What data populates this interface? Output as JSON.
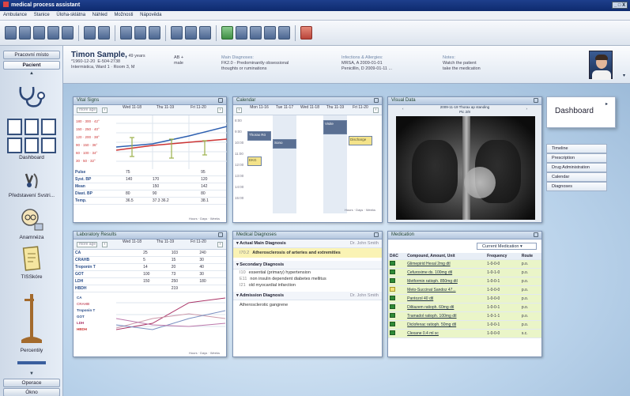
{
  "window": {
    "title": "medical process assistant",
    "control": "_ □ X"
  },
  "menu": [
    "Ambulance",
    "Stanice",
    "Úloha-sklátna",
    "Náhled",
    "Možnosti",
    "Nápověda"
  ],
  "nav": {
    "top_buttons": [
      "Pracovní místo",
      "Pacient"
    ],
    "items": [
      "Dashboard",
      "Představení Svstri...",
      "Anamnéza",
      "TISSkóre",
      "Percentily"
    ],
    "bottom_buttons": [
      "Operace",
      "Ókno"
    ]
  },
  "patient": {
    "name": "Timon Sample,",
    "age": "49 years",
    "dob": "*1960-12-20",
    "id": "E-504-2738",
    "location": "Intermistica, Ward 1 · Room 3, M",
    "blood": "AB +",
    "sex": "male",
    "main_diag_head": "Main Diagnoses:",
    "main_diag": [
      "FK2.0 - Predominantly obsessional",
      "thoughts or ruminations"
    ],
    "inf_head": "Infections & Allergies:",
    "infections": [
      "MRSA, A 2009-01-01",
      "Penicillin, D 2009-01-11 ..."
    ],
    "notes_head": "Notes:",
    "notes": [
      "Watch the patient",
      "take the medication"
    ]
  },
  "vital": {
    "title": "Vital Signs",
    "dd": "more age",
    "cols": [
      "Wed 11-18",
      "Thu 11-19",
      "Fri 11-20"
    ],
    "scale": [
      "180 · 300 · 42°",
      "150 · 250 · 40°",
      "120 · 200 · 38°",
      "90 · 150 · 36°",
      "60 · 100 · 34°",
      "30 · 50 · 32°"
    ],
    "rows": [
      [
        "Pulse",
        "75",
        "",
        "95"
      ],
      [
        "Syst. BP",
        "140",
        "170",
        "120"
      ],
      [
        "Mean",
        "",
        "150",
        "142"
      ],
      [
        "Diast. BP",
        "80",
        "90",
        "80"
      ],
      [
        "Temp.",
        "36.5",
        "37.3 36.2",
        "38.1"
      ]
    ],
    "zoom": "Hours · Days · Weeks"
  },
  "calendar": {
    "title": "Calendar",
    "cols": [
      "Mon 11-16",
      "Tue 11-17",
      "Wed 11-18",
      "Thu 11-19",
      "Fri 11-20"
    ],
    "times": [
      "8:00",
      "9:00",
      "10:00",
      "11:00",
      "12:00",
      "13:00",
      "14:00",
      "15:00"
    ],
    "events": [
      "Thorax Rö",
      "Sono",
      "EKG",
      "Visite",
      "Discharge"
    ],
    "zoom": "Hours · Days · Weeks"
  },
  "visual": {
    "title": "Visual Data",
    "caption": "2009-11-19 Thorax ap standing",
    "page": "Pic 2/8"
  },
  "dashboard_tab": "Dashboard",
  "side_tabs": [
    "Timeline",
    "Prescription",
    "Drug Administration",
    "Calendar",
    "Diagnoses"
  ],
  "lab": {
    "title": "Laboratory Results",
    "dd": "more age",
    "cols": [
      "Wed 11-18",
      "Thu 11-19",
      "Fri 11-20"
    ],
    "rows": [
      [
        "CA",
        "",
        "25",
        "103",
        "240"
      ],
      [
        "CRAHB",
        "",
        "5",
        "15",
        "30"
      ],
      [
        "Troponin T",
        "",
        "14",
        "20",
        "40"
      ],
      [
        "GOT",
        "",
        "100",
        "73",
        "30"
      ],
      [
        "LDH",
        "",
        "150",
        "250",
        "180"
      ],
      [
        "HBDH",
        "",
        "",
        "219",
        ""
      ]
    ],
    "rows2": [
      "CA",
      "CRAHB",
      "Troponin T",
      "GOT",
      "LDH",
      "HBDH"
    ],
    "zoom": "Hours · Days · Weeks"
  },
  "diag": {
    "title": "Medical Diagnoses",
    "sec1": "Actual Main Diagnosis",
    "doctor": "Dr. John Smith",
    "main": [
      "I70.2",
      "Atherosclerosis of arteries and extremities"
    ],
    "sec2": "Secondary Diagnosis",
    "secondary": [
      [
        "I10",
        "essential (primary) hypertension"
      ],
      [
        "E11",
        "non insulin dependent diabetes mellitus"
      ],
      [
        "I21",
        "old myocardial infarction"
      ]
    ],
    "sec3": "Admission Diagnosis",
    "admission": "Atherosclerotic gangrene"
  },
  "meds": {
    "title": "Medication",
    "selector": "Current Medication  ▾",
    "headers": [
      "DAC",
      "Compound, Amount, Unit",
      "Frequency",
      "Route"
    ],
    "rows": [
      [
        "Glimepirid Hexal 2mg dtl",
        "1-0-0-0",
        "p.o."
      ],
      [
        "Cefuroxime ds. 100mg dtl",
        "1-0-1-0",
        "p.o."
      ],
      [
        "Metformin ratioph. 850mg dtl",
        "1-0-0-1",
        "p.o."
      ],
      [
        "Meto-Succinat Sandoz 47...",
        "1-0-0-0",
        "p.o."
      ],
      [
        "Pantozol 40 dtl",
        "1-0-0-0",
        "p.o."
      ],
      [
        "Diltiazem ratioph. 60mg dtl",
        "1-0-0-1",
        "p.o."
      ],
      [
        "Tramadol ratioph. 100mg dtl",
        "1-0-1-1",
        "p.o."
      ],
      [
        "Diclofenac ratioph. 50mg dtl",
        "1-0-0-1",
        "p.o."
      ],
      [
        "Clexane 0.4 ml sc",
        "1-0-0-0",
        "s.c."
      ]
    ]
  },
  "colors": {
    "accent": "#1e3f8c",
    "panel_header": "#b3c6de",
    "med_row": "#eaf5c8"
  }
}
